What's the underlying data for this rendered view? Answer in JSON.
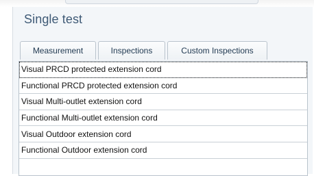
{
  "panel": {
    "title": "Single test"
  },
  "tabs": [
    {
      "label": "Measurement"
    },
    {
      "label": "Inspections"
    },
    {
      "label": "Custom Inspections"
    }
  ],
  "list": {
    "items": [
      "Visual PRCD protected extension cord",
      "Functional PRCD protected extension cord",
      "Visual Multi-outlet extension cord",
      "Functional Multi-outlet extension cord",
      "Visual Outdoor extension cord",
      "Functional Outdoor extension cord"
    ]
  },
  "colors": {
    "title_text": "#3f5a76",
    "panel_bg": "#f3f6f9",
    "border": "#b9c3cc"
  }
}
